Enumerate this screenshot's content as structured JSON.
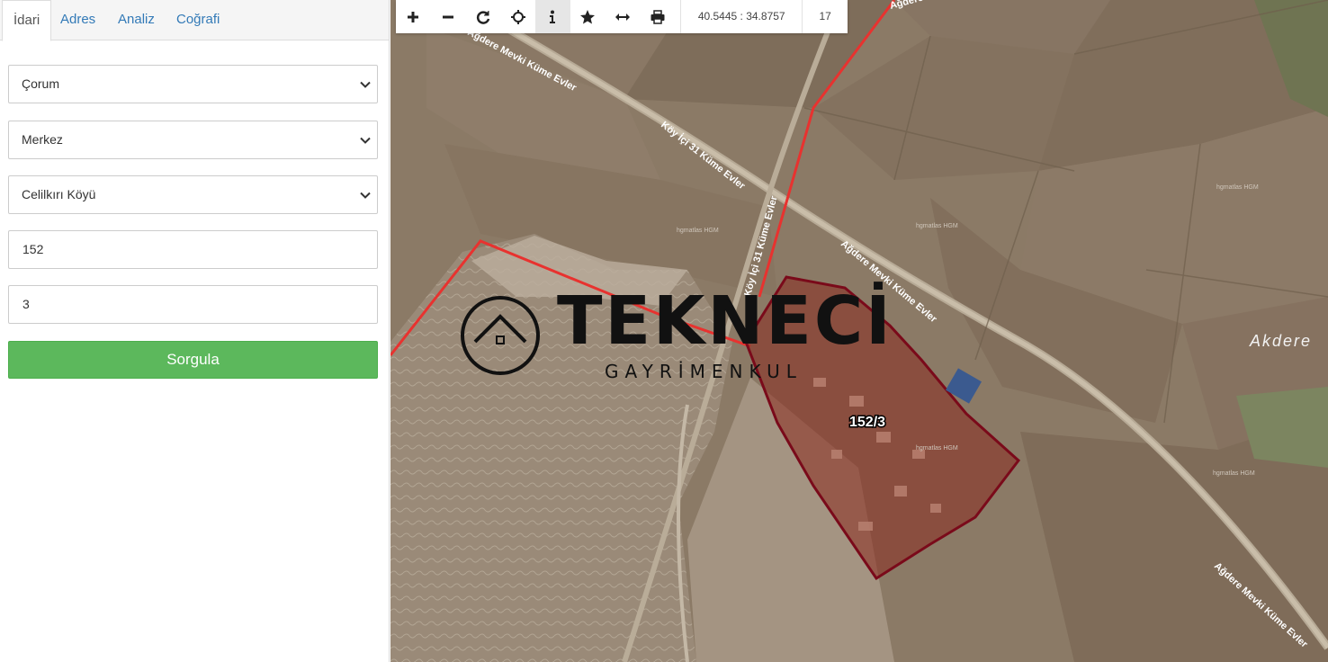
{
  "tabs": [
    {
      "label": "İdari",
      "active": true
    },
    {
      "label": "Adres",
      "active": false
    },
    {
      "label": "Analiz",
      "active": false
    },
    {
      "label": "Coğrafi",
      "active": false
    }
  ],
  "form": {
    "province": "Çorum",
    "district": "Merkez",
    "neighborhood": "Celilkırı Köyü",
    "block": "152",
    "parcel": "3",
    "query_label": "Sorgula"
  },
  "toolbar": {
    "icons": [
      "plus-icon",
      "minus-icon",
      "refresh-icon",
      "crosshair-icon",
      "info-icon",
      "star-icon",
      "measure-icon",
      "print-icon"
    ],
    "active_tool": "info-icon",
    "coordinates": "40.5445 : 34.8757",
    "zoom": "17"
  },
  "map": {
    "parcel_label": "152/3",
    "watermark_title": "TEKNECİ",
    "watermark_subtitle": "GAYRİMENKUL",
    "place_label": "Akdere",
    "road_labels": [
      "Ağdere Mevki Küme Evler",
      "Köy İçi 31 Küme Evler",
      "Köy İçi 31 Küme Evler",
      "Ağdere Mevki Küme Evler",
      "Ağdere Mevki Küme Evler",
      "Ağdere Mevki Küme Evler"
    ],
    "hgm_labels": [
      "hgmatlas HGM",
      "hgmatlas HGM",
      "hgmatlas HGM",
      "hgmatlas HGM",
      "hgmatlas HGM"
    ],
    "colors": {
      "parcel_fill": "#8a2a1f",
      "parcel_stroke": "#7a0a1a",
      "boundary": "#e8322f",
      "button": "#5cb85c"
    }
  }
}
